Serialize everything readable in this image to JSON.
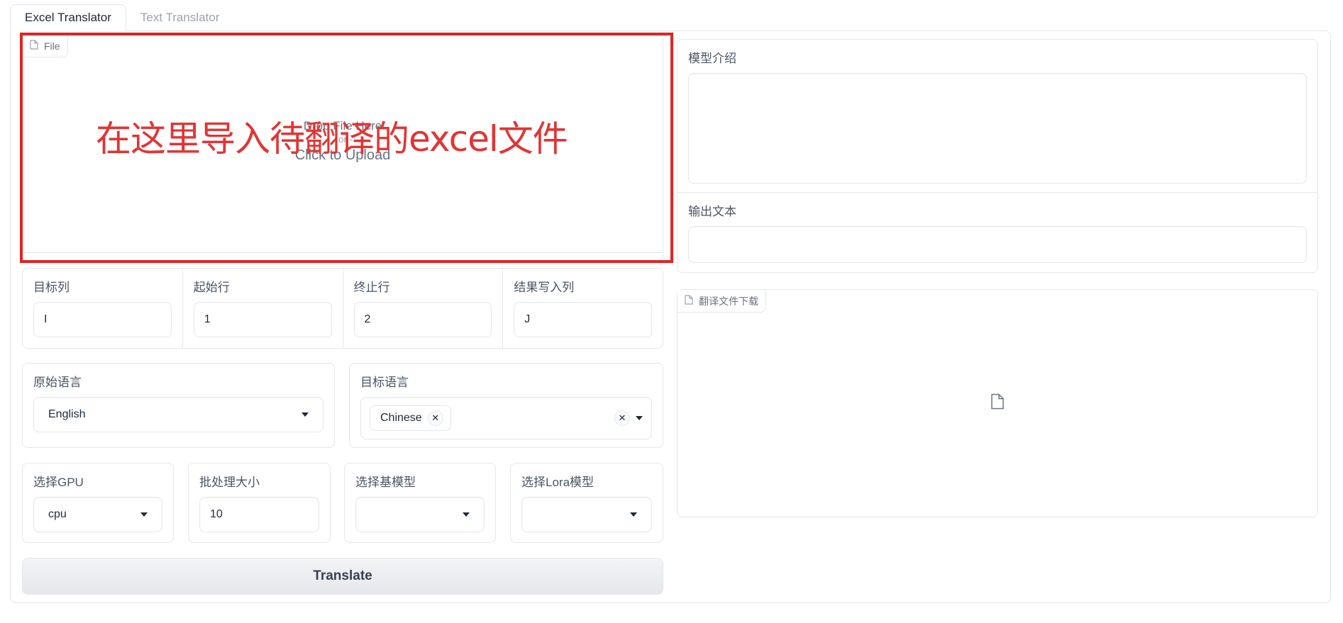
{
  "tabs": [
    {
      "label": "Excel Translator",
      "active": true
    },
    {
      "label": "Text Translator",
      "active": false
    }
  ],
  "upload": {
    "badge": "File",
    "drop_text": "Drop File Here",
    "or_text": "- or -",
    "click_text": "Click to Upload",
    "annotation": "在这里导入待翻译的excel文件",
    "annotation_color": "#e02424"
  },
  "params": {
    "target_col": {
      "label": "目标列",
      "value": "I"
    },
    "start_row": {
      "label": "起始行",
      "value": "1"
    },
    "end_row": {
      "label": "终止行",
      "value": "2"
    },
    "result_col": {
      "label": "结果写入列",
      "value": "J"
    }
  },
  "source_lang": {
    "label": "原始语言",
    "value": "English"
  },
  "target_lang": {
    "label": "目标语言",
    "chips": [
      "Chinese"
    ]
  },
  "gpu": {
    "label": "选择GPU",
    "value": "cpu"
  },
  "batch": {
    "label": "批处理大小",
    "value": "10"
  },
  "base_model": {
    "label": "选择基模型",
    "value": ""
  },
  "lora_model": {
    "label": "选择Lora模型",
    "value": ""
  },
  "translate_button": "Translate",
  "right_panel": {
    "model_intro_label": "模型介绍",
    "model_intro_value": "",
    "output_label": "输出文本",
    "output_value": "",
    "download_label": "翻译文件下载"
  }
}
